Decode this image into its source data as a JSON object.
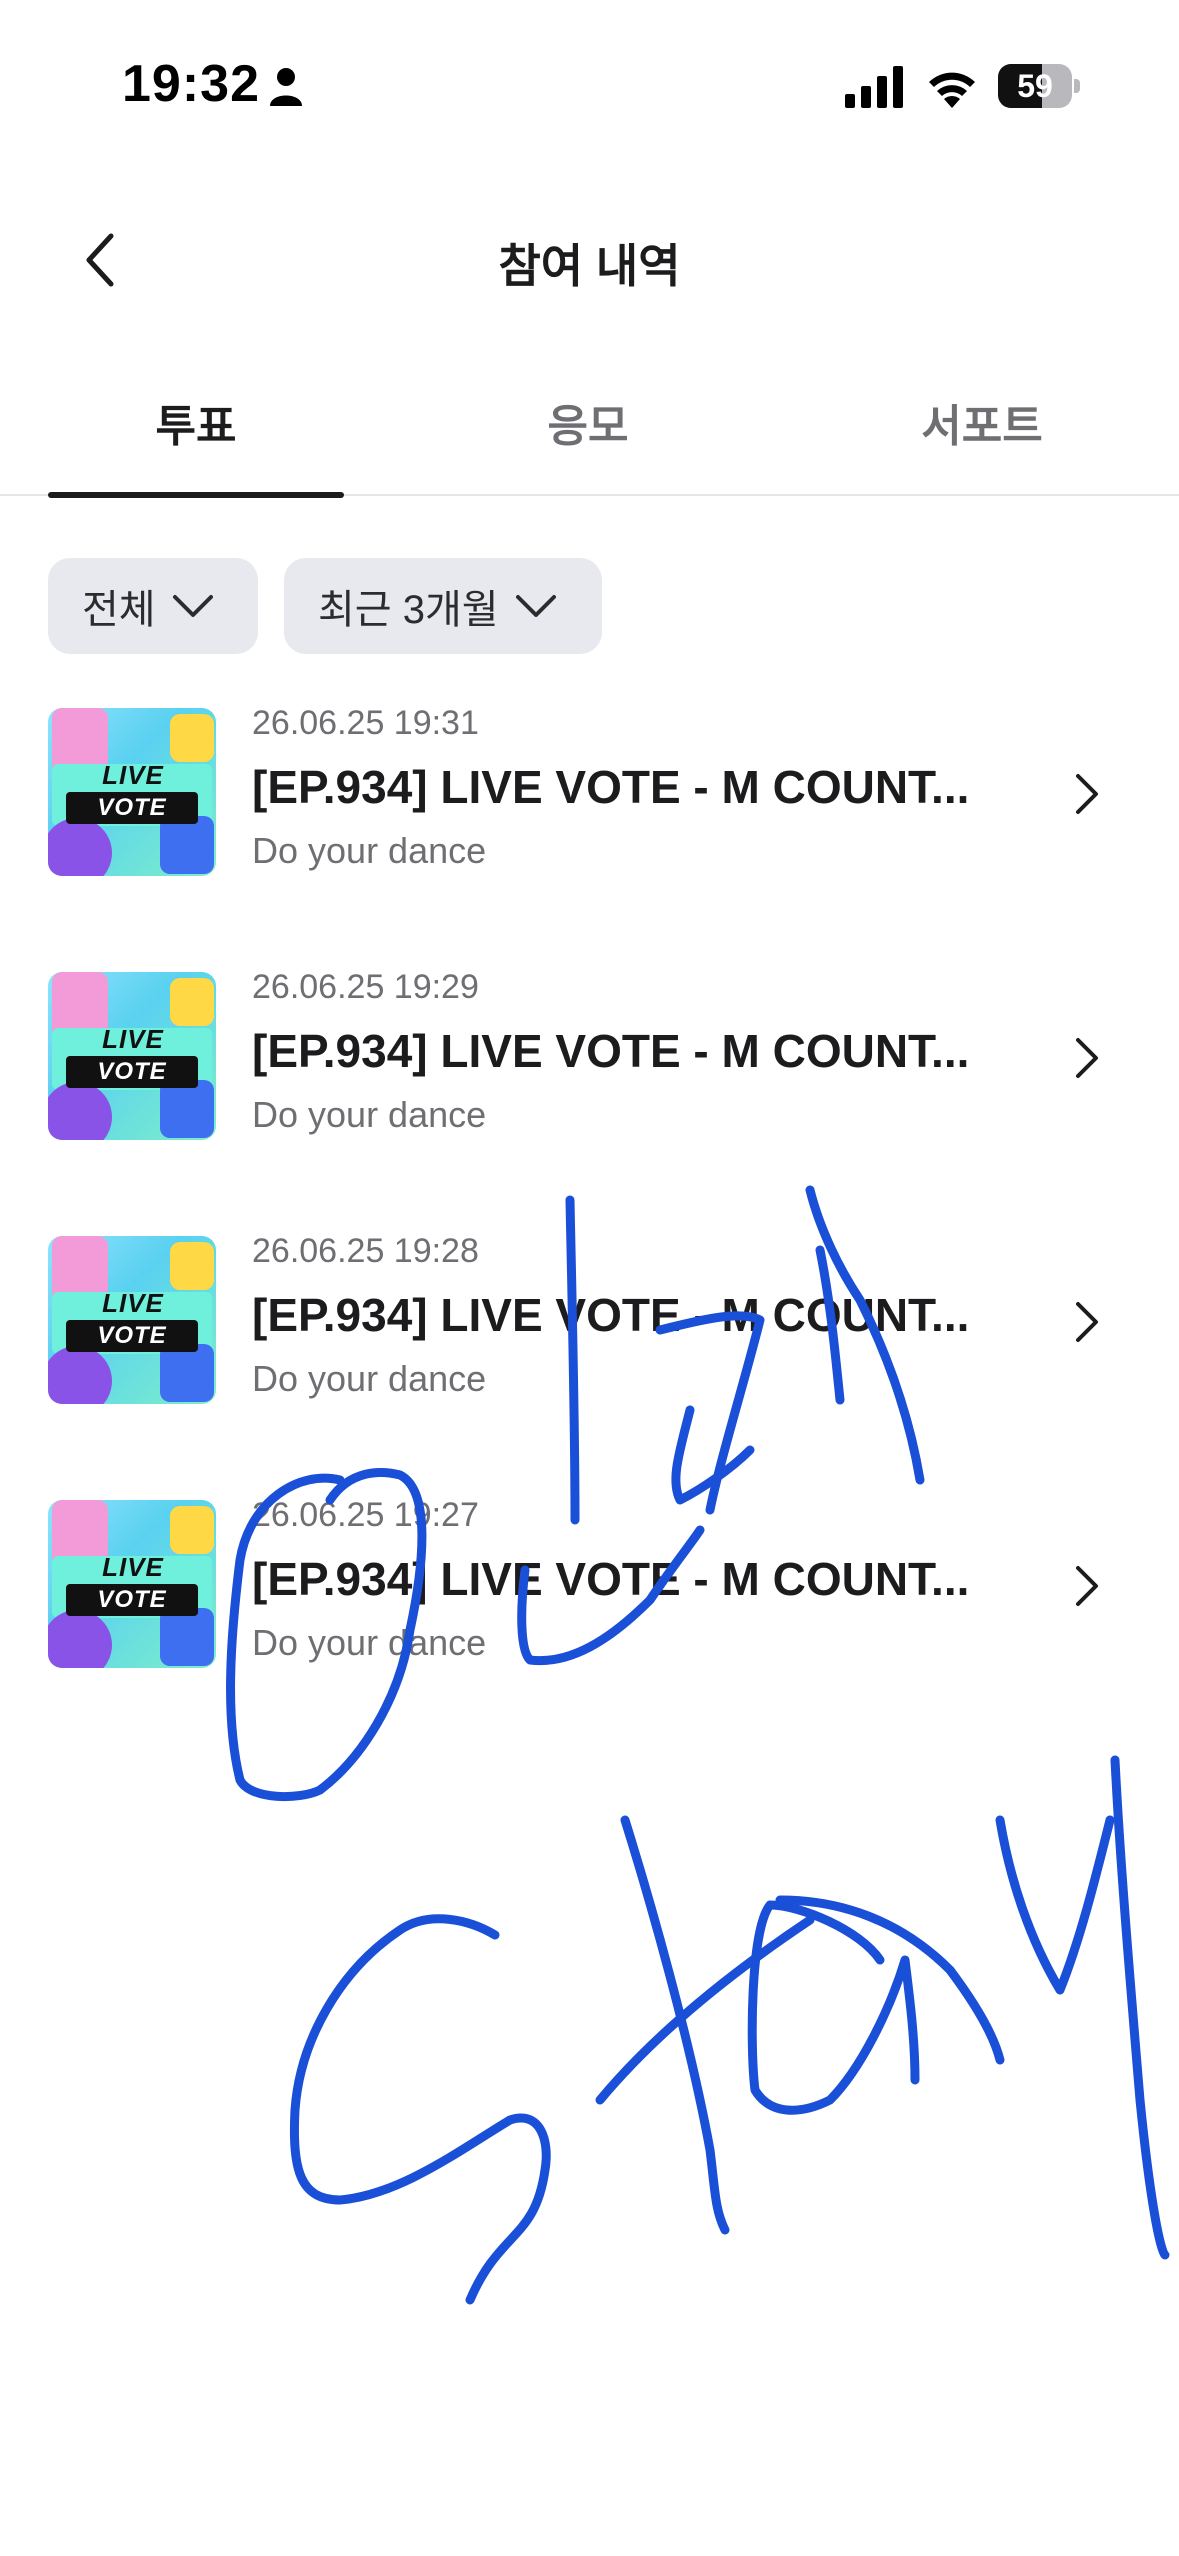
{
  "status_bar": {
    "time": "19:32",
    "battery": "59",
    "battery_level": 0.59,
    "icons": [
      "person-icon",
      "signal-icon",
      "wifi-icon",
      "battery-icon"
    ]
  },
  "header": {
    "title": "참여 내역",
    "back_icon": "chevron-left-icon"
  },
  "tabs": [
    {
      "label": "투표",
      "active": true
    },
    {
      "label": "응모",
      "active": false
    },
    {
      "label": "서포트",
      "active": false
    }
  ],
  "filters": {
    "type": "전체",
    "period": "최근 3개월"
  },
  "items": [
    {
      "date": "26.06.25 19:31",
      "title": "[EP.934] LIVE VOTE - M COUNT...",
      "subtitle": "Do your dance",
      "thumb_live": "LIVE",
      "thumb_vote": "VOTE"
    },
    {
      "date": "26.06.25 19:29",
      "title": "[EP.934] LIVE VOTE - M COUNT...",
      "subtitle": "Do your dance",
      "thumb_live": "LIVE",
      "thumb_vote": "VOTE"
    },
    {
      "date": "26.06.25 19:28",
      "title": "[EP.934] LIVE VOTE - M COUNT...",
      "subtitle": "Do your dance",
      "thumb_live": "LIVE",
      "thumb_vote": "VOTE"
    },
    {
      "date": "26.06.25 19:27",
      "title": "[EP.934] LIVE VOTE - M COUNT...",
      "subtitle": "Do your dance",
      "thumb_live": "LIVE",
      "thumb_vote": "VOTE"
    }
  ],
  "overlay": {
    "description": "handwritten blue marker scribble",
    "color": "#1a4fd8"
  }
}
